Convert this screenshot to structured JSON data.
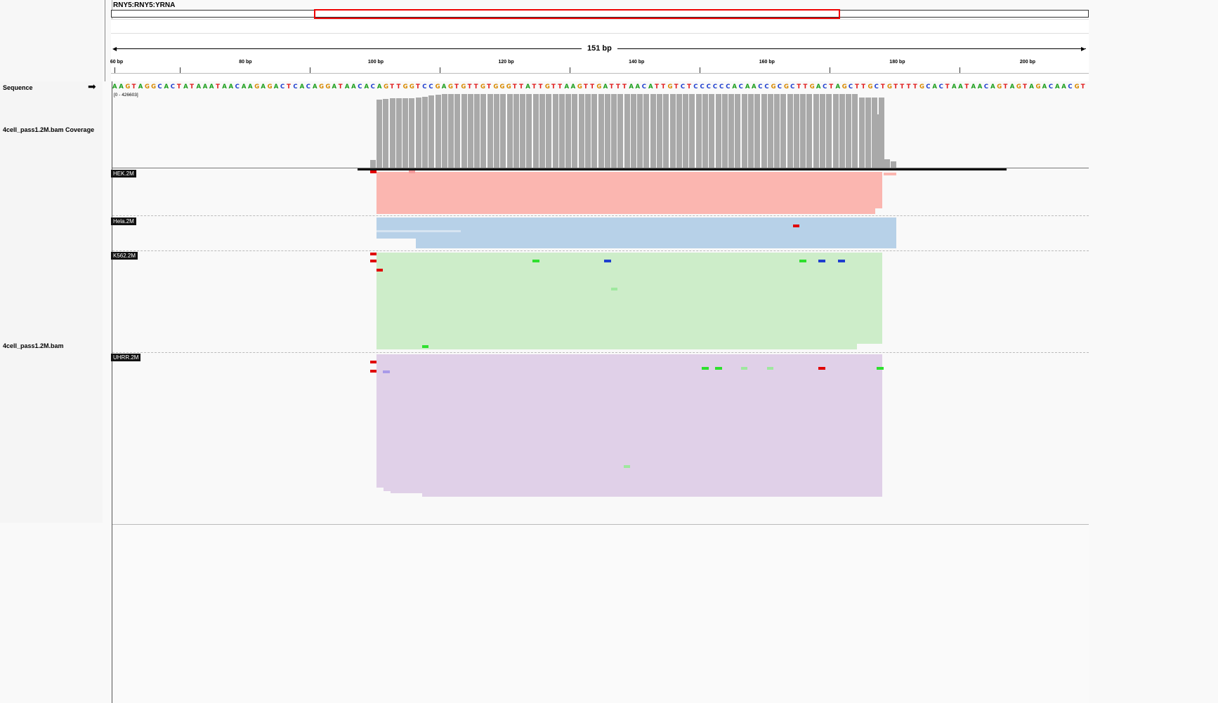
{
  "header": {
    "locus": "RNY5:RNY5:YRNA",
    "span_label": "151 bp",
    "ticks": [
      "60 bp",
      "80 bp",
      "100 bp",
      "120 bp",
      "140 bp",
      "160 bp",
      "180 bp",
      "200 bp"
    ]
  },
  "tracks": {
    "sequence_label": "Sequence",
    "strand_arrow": "➡",
    "coverage_label": "4cell_pass1.2M.bam Coverage",
    "coverage_range": "[0 - 426603]",
    "alignment_label": "4cell_pass1.2M.bam"
  },
  "sequence": "AAGTAGGCACTATAAATAACAAGAGACTCACAGGATAACACAGTTGGTCCGAGTGTTGTGGGTTATTGTTAAGTTGATTTAACATTGTCTCCCCCCACAACCGCGCTTGACTAGCTTGCTGTTTTGCACTAATAACAGTAGTAGACAACGT",
  "base_colors": {
    "A": "#1a9e1a",
    "C": "#1f3fcf",
    "G": "#d88a00",
    "T": "#e01b1b"
  },
  "samples": [
    {
      "name": "HEK.2M",
      "color": "#fbb6b0"
    },
    {
      "name": "Hela.2M",
      "color": "#b7d1e8"
    },
    {
      "name": "K562.2M",
      "color": "#cdedc9"
    },
    {
      "name": "UHRR.2M",
      "color": "#e0d0e8"
    }
  ],
  "icons": {
    "strand": "arrow-right-icon"
  }
}
